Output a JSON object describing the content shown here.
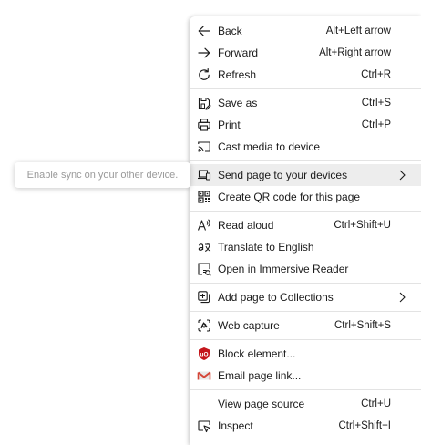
{
  "tooltip": {
    "text": "Enable sync on your other device."
  },
  "menu": {
    "items": [
      {
        "label": "Back",
        "shortcut": "Alt+Left arrow",
        "icon": "back-arrow-icon"
      },
      {
        "label": "Forward",
        "shortcut": "Alt+Right arrow",
        "icon": "forward-arrow-icon"
      },
      {
        "label": "Refresh",
        "shortcut": "Ctrl+R",
        "icon": "refresh-icon"
      },
      {
        "label": "Save as",
        "shortcut": "Ctrl+S",
        "icon": "save-icon"
      },
      {
        "label": "Print",
        "shortcut": "Ctrl+P",
        "icon": "printer-icon"
      },
      {
        "label": "Cast media to device",
        "shortcut": "",
        "icon": "cast-icon"
      },
      {
        "label": "Send page to your devices",
        "shortcut": "",
        "icon": "send-to-devices-icon",
        "submenu": true,
        "highlighted": true
      },
      {
        "label": "Create QR code for this page",
        "shortcut": "",
        "icon": "qr-code-icon"
      },
      {
        "label": "Read aloud",
        "shortcut": "Ctrl+Shift+U",
        "icon": "read-aloud-icon"
      },
      {
        "label": "Translate to English",
        "shortcut": "",
        "icon": "translate-icon"
      },
      {
        "label": "Open in Immersive Reader",
        "shortcut": "",
        "icon": "immersive-reader-icon"
      },
      {
        "label": "Add page to Collections",
        "shortcut": "",
        "icon": "collections-icon",
        "submenu": true
      },
      {
        "label": "Web capture",
        "shortcut": "Ctrl+Shift+S",
        "icon": "web-capture-icon"
      },
      {
        "label": "Block element...",
        "shortcut": "",
        "icon": "ublock-icon"
      },
      {
        "label": "Email page link...",
        "shortcut": "",
        "icon": "email-icon"
      },
      {
        "label": "View page source",
        "shortcut": "Ctrl+U",
        "icon": ""
      },
      {
        "label": "Inspect",
        "shortcut": "Ctrl+Shift+I",
        "icon": "inspect-icon"
      }
    ]
  },
  "colors": {
    "ublock_red": "#c4161c",
    "email_red": "#d44638",
    "highlight": "#ededed"
  }
}
